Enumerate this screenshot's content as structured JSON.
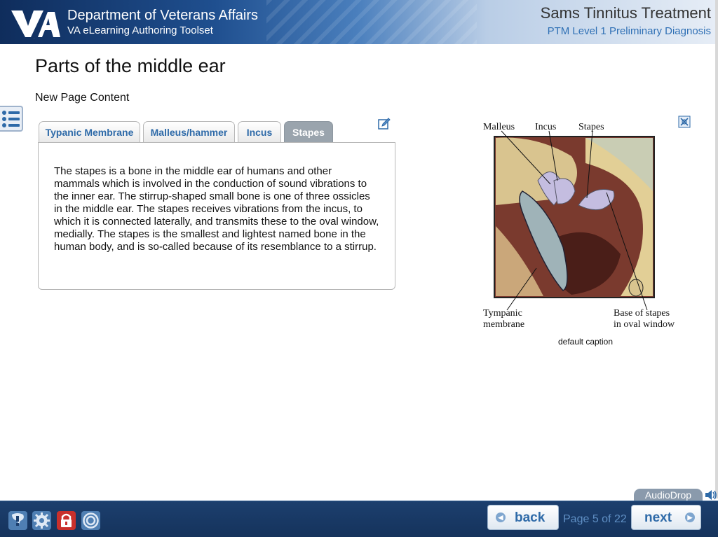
{
  "header": {
    "org": "Department of Veterans Affairs",
    "tool": "VA eLearning Authoring Toolset",
    "course_title": "Sams Tinnitus Treatment",
    "module_title": "PTM Level 1 Preliminary Diagnosis",
    "logo_text": "VA"
  },
  "page": {
    "title": "Parts of the middle ear",
    "subtitle": "New Page Content"
  },
  "tabs": [
    {
      "label": "Typanic Membrane",
      "active": false
    },
    {
      "label": "Malleus/hammer",
      "active": false
    },
    {
      "label": "Incus",
      "active": false
    },
    {
      "label": "Stapes",
      "active": true
    }
  ],
  "tab_content": "The stapes is a bone in the middle ear of humans and other mammals which is involved in the conduction of sound vibrations to the inner ear. The stirrup-shaped small bone is one of three ossicles in the middle ear. The stapes receives vibrations from the incus, to which it is connected laterally, and transmits these to the oval window, medially. The stapes is the smallest and lightest named bone in the human body, and is so-called because of its resemblance to a stirrup.",
  "figure": {
    "labels": {
      "malleus": "Malleus",
      "incus": "Incus",
      "stapes": "Stapes",
      "tympanic_1": "Tympanic",
      "tympanic_2": "membrane",
      "base_1": "Base of stapes",
      "base_2": "in oval window"
    },
    "caption": "default caption"
  },
  "audiodrop": {
    "label": "AudioDrop"
  },
  "footer": {
    "back_label": "back",
    "next_label": "next",
    "page_indicator": "Page 5 of 22"
  },
  "colors": {
    "header_dark": "#0f2d5c",
    "footer": "#1c3f6e",
    "tab_text": "#2e6aa8",
    "tab_active_bg": "#9aa4ad",
    "page_indicator": "#5f8fc4"
  },
  "icons": [
    "va-logo-icon",
    "menu-list-icon",
    "edit-pencil-icon",
    "expand-icon",
    "speaker-icon",
    "help-icon",
    "settings-icon",
    "lock-icon",
    "target-icon",
    "back-arrow-icon",
    "next-arrow-icon"
  ]
}
